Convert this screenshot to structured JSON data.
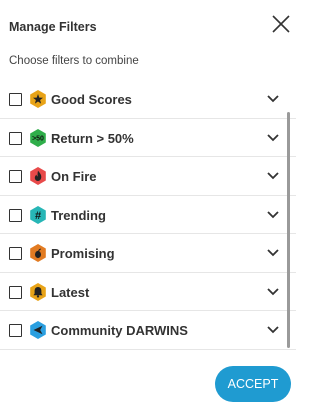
{
  "dialog": {
    "title": "Manage Filters",
    "subtitle": "Choose filters to combine",
    "accept_label": "ACCEPT"
  },
  "filters": [
    {
      "label": "Good Scores",
      "icon": "star-icon",
      "color": "#e8a317",
      "badge_text": "",
      "checked": false
    },
    {
      "label": "Return > 50%",
      "icon": "gt50-icon",
      "color": "#2fae4a",
      "badge_text": ">50",
      "checked": false
    },
    {
      "label": "On Fire",
      "icon": "fire-icon",
      "color": "#e84a4a",
      "badge_text": "",
      "checked": false
    },
    {
      "label": "Trending",
      "icon": "hashtag-icon",
      "color": "#27b6b6",
      "badge_text": "#",
      "checked": false
    },
    {
      "label": "Promising",
      "icon": "seedling-icon",
      "color": "#e27b22",
      "badge_text": "",
      "checked": false
    },
    {
      "label": "Latest",
      "icon": "bell-icon",
      "color": "#e8a317",
      "badge_text": "",
      "checked": false
    },
    {
      "label": "Community DARWINS",
      "icon": "community-icon",
      "color": "#2a9fe0",
      "badge_text": "",
      "checked": false
    }
  ],
  "colors": {
    "accent": "#1f9bd1",
    "text": "#333333"
  }
}
